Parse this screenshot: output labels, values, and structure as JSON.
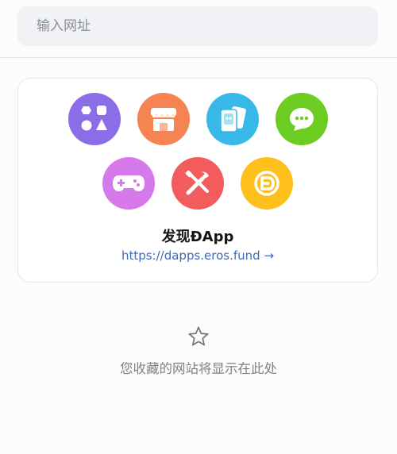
{
  "search": {
    "placeholder": "输入网址"
  },
  "discover": {
    "title": "发现ĐApp",
    "link": "https://dapps.eros.fund",
    "link_arrow": "→",
    "apps": [
      {
        "name": "app-shapes",
        "icon": "shapes-icon",
        "color": "#8b6de8"
      },
      {
        "name": "app-store",
        "icon": "store-icon",
        "color": "#f68452"
      },
      {
        "name": "app-cards",
        "icon": "cards-icon",
        "color": "#38b8e8"
      },
      {
        "name": "app-chat",
        "icon": "chat-icon",
        "color": "#6ccc22"
      },
      {
        "name": "app-game",
        "icon": "gamepad-icon",
        "color": "#d679ea"
      },
      {
        "name": "app-tools",
        "icon": "tools-icon",
        "color": "#f25c5c"
      },
      {
        "name": "app-coin",
        "icon": "coin-icon",
        "color": "#fdbf1c"
      }
    ]
  },
  "favorites": {
    "icon": "star-icon",
    "empty_text": "您收藏的网站将显示在此处"
  }
}
